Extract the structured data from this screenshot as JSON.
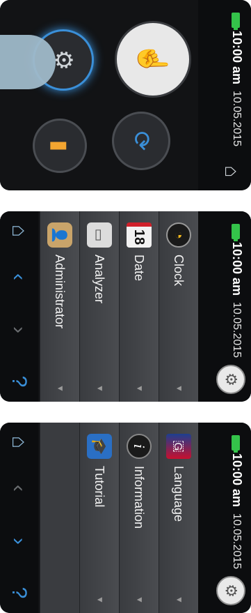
{
  "screens": [
    {
      "status": {
        "time": "10:00 am",
        "date": "10.05.2015"
      },
      "menu": [
        {
          "label": "Language",
          "icon": "flag-icon"
        },
        {
          "label": "Information",
          "icon": "info-icon"
        },
        {
          "label": "Tutorial",
          "icon": "graduation-cap-icon"
        },
        {
          "label": "",
          "icon": ""
        }
      ],
      "footer": {
        "home": "home-icon",
        "up": "chevron-up-icon",
        "down": "chevron-down-icon",
        "help": "help-icon"
      }
    },
    {
      "status": {
        "time": "10:00 am",
        "date": "10.05.2015"
      },
      "menu": [
        {
          "label": "Clock",
          "icon": "clock-icon"
        },
        {
          "label": "Date",
          "icon": "calendar-icon",
          "icon_text": "18"
        },
        {
          "label": "Analyzer",
          "icon": "analyzer-icon"
        },
        {
          "label": "Administrator",
          "icon": "administrator-icon"
        }
      ],
      "footer": {
        "home": "home-icon",
        "up": "chevron-up-icon",
        "down": "chevron-down-icon",
        "help": "help-icon"
      }
    },
    {
      "status": {
        "time": "10:00 am",
        "date": "10.05.2015"
      },
      "home_screen": true
    }
  ],
  "colors": {
    "battery": "#34c34a",
    "accent_blue": "#3a8fd8",
    "background": "#121315"
  }
}
